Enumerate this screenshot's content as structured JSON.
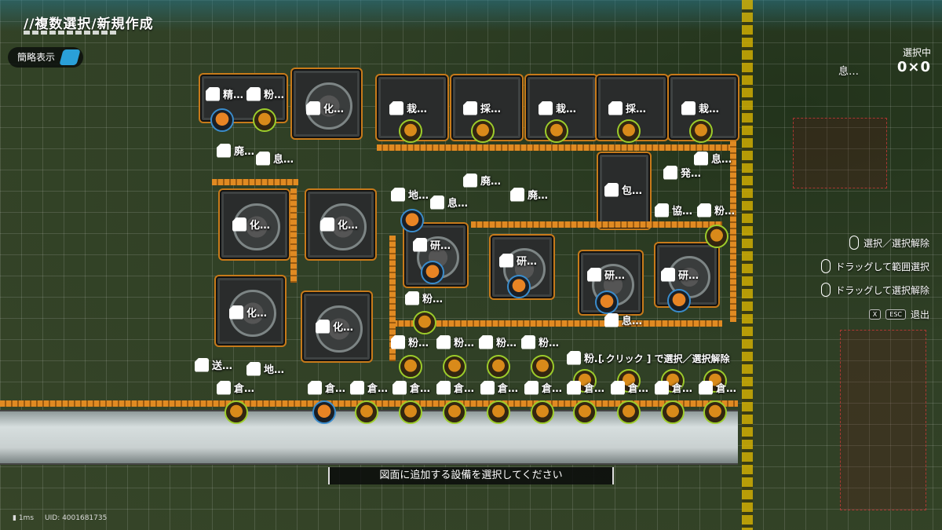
{
  "header": {
    "title": "//複数選択/新規作成"
  },
  "toolbar": {
    "brief_view_label": "簡略表示"
  },
  "selection": {
    "label": "選択中",
    "value": "0×0"
  },
  "status_right": {
    "label": "息…"
  },
  "controls": [
    {
      "label": "選択／選択解除",
      "type": "mouse"
    },
    {
      "label": "ドラッグして範囲選択",
      "type": "mouse"
    },
    {
      "label": "ドラッグして選択解除",
      "type": "mouse"
    },
    {
      "label": "退出",
      "keys": [
        "X",
        "ESC"
      ]
    }
  ],
  "map_labels": [
    {
      "id": "l1",
      "text": "精…"
    },
    {
      "id": "l2",
      "text": "粉…"
    },
    {
      "id": "l3",
      "text": "化…"
    },
    {
      "id": "l4",
      "text": "栽…"
    },
    {
      "id": "l5",
      "text": "採…"
    },
    {
      "id": "l6",
      "text": "栽…"
    },
    {
      "id": "l7",
      "text": "採…"
    },
    {
      "id": "l8",
      "text": "栽…"
    },
    {
      "id": "l9",
      "text": "廃…"
    },
    {
      "id": "l10",
      "text": "息…"
    },
    {
      "id": "l11",
      "text": "息…"
    },
    {
      "id": "l12",
      "text": "発…"
    },
    {
      "id": "l13",
      "text": "廃…"
    },
    {
      "id": "l14",
      "text": "廃…"
    },
    {
      "id": "l15",
      "text": "地…"
    },
    {
      "id": "l16",
      "text": "息…"
    },
    {
      "id": "l17",
      "text": "包…"
    },
    {
      "id": "l18",
      "text": "協…"
    },
    {
      "id": "l19",
      "text": "粉…"
    },
    {
      "id": "l20",
      "text": "化…"
    },
    {
      "id": "l21",
      "text": "化…"
    },
    {
      "id": "l22",
      "text": "研…"
    },
    {
      "id": "l23",
      "text": "研…"
    },
    {
      "id": "l24",
      "text": "研…"
    },
    {
      "id": "l25",
      "text": "研…"
    },
    {
      "id": "l26",
      "text": "粉…"
    },
    {
      "id": "l27",
      "text": "化…"
    },
    {
      "id": "l28",
      "text": "化…"
    },
    {
      "id": "l29",
      "text": "息…"
    },
    {
      "id": "l30",
      "text": "粉…"
    },
    {
      "id": "l31",
      "text": "粉…"
    },
    {
      "id": "l32",
      "text": "粉…"
    },
    {
      "id": "l33",
      "text": "粉…"
    },
    {
      "id": "l34",
      "text": "粉…"
    },
    {
      "id": "l35",
      "text": "送…"
    },
    {
      "id": "l36",
      "text": "地…"
    },
    {
      "id": "l37",
      "text": "倉…"
    },
    {
      "id": "l38",
      "text": "倉…"
    },
    {
      "id": "l39",
      "text": "倉…"
    },
    {
      "id": "l40",
      "text": "倉…"
    },
    {
      "id": "l41",
      "text": "倉…"
    },
    {
      "id": "l42",
      "text": "倉…"
    },
    {
      "id": "l43",
      "text": "倉…"
    },
    {
      "id": "l44",
      "text": "倉…"
    },
    {
      "id": "l45",
      "text": "倉…"
    },
    {
      "id": "l46",
      "text": "倉…"
    },
    {
      "id": "l47",
      "text": "倉…"
    },
    {
      "id": "l48",
      "text": "倉…"
    }
  ],
  "overlap_text": "[ クリック ] で選択／選択解除",
  "hint": "図面に追加する設備を選択してください",
  "footer": {
    "latency": "1ms",
    "uid": "UID: 4001681735"
  },
  "colors": {
    "belt": "#e08a22",
    "hazard_line": "#d9b400",
    "accent_blue": "#2aa0d8"
  }
}
